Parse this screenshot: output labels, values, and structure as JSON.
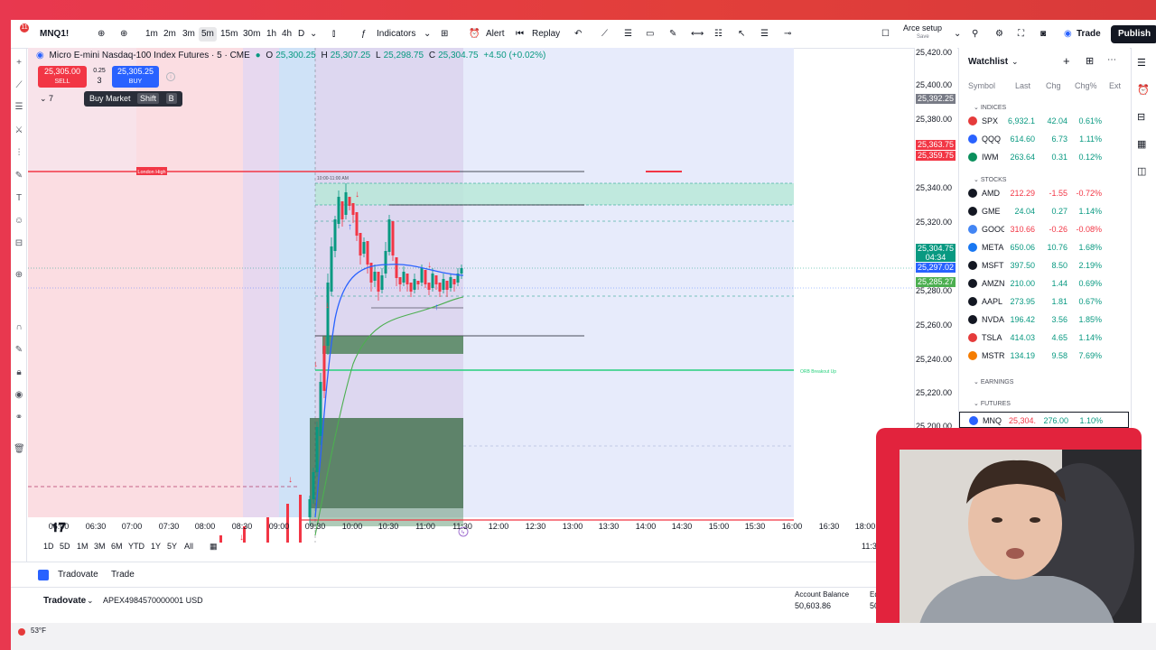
{
  "toolbar": {
    "symbol": "MNQ1!",
    "notif_count": "11",
    "timeframes": [
      "1m",
      "2m",
      "3m",
      "5m",
      "15m",
      "30m",
      "1h",
      "4h",
      "D"
    ],
    "active_timeframe": "5m",
    "indicators_label": "Indicators",
    "alert_label": "Alert",
    "replay_label": "Replay",
    "layout_name": "Arce setup",
    "layout_sub": "Save",
    "trade_label": "Trade",
    "publish_label": "Publish"
  },
  "legend": {
    "title": "Micro E-mini Nasdaq-100 Index Futures · 5 · CME",
    "o_label": "O",
    "o": "25,300.25",
    "h_label": "H",
    "h": "25,307.25",
    "l_label": "L",
    "l": "25,298.75",
    "c_label": "C",
    "c": "25,304.75",
    "change": "+4.50 (+0.02%)"
  },
  "order": {
    "sell_price": "25,305.00",
    "sell_label": "SELL",
    "spread": "0.25",
    "qty": "3",
    "buy_price": "25,305.25",
    "buy_label": "BUY",
    "tooltip": "Buy Market",
    "key1": "Shift",
    "key2": "B",
    "indicator_count": "7"
  },
  "annotations": {
    "london_high": "London High",
    "session_box": "10:00-11:00 AM",
    "orb_label": "ORB Breakout Up"
  },
  "price_axis": {
    "labels": [
      "25,420.00",
      "25,400.00",
      "25,380.00",
      "25,340.00",
      "25,320.00",
      "25,280.00",
      "25,260.00",
      "25,240.00",
      "25,220.00",
      "25,200.00"
    ],
    "tag_grey": "25,392.25",
    "tag_red1": "25,363.75",
    "tag_red2": "25,359.75",
    "tag_green_price": "25,304.75",
    "tag_green_time": "04:34",
    "tag_blue": "25,297.02",
    "tag_green2": "25,285.27"
  },
  "time_axis": [
    "06:00",
    "06:30",
    "07:00",
    "07:30",
    "08:00",
    "08:30",
    "09:00",
    "09:30",
    "10:00",
    "10:30",
    "11:00",
    "11:30",
    "12:00",
    "12:30",
    "13:00",
    "13:30",
    "14:00",
    "14:30",
    "15:00",
    "15:30",
    "16:00",
    "16:30",
    "18:00"
  ],
  "range_bar": {
    "ranges": [
      "1D",
      "5D",
      "1M",
      "3M",
      "6M",
      "YTD",
      "1Y",
      "5Y",
      "All"
    ],
    "clock": "11:30:25 UTC"
  },
  "bottom": {
    "tab1": "Tradovate",
    "tab2": "Trade",
    "broker": "Tradovate",
    "account": "APEX4984570000001 USD",
    "balance_label": "Account Balance",
    "balance_value": "50,603.86",
    "equity_label": "Eq",
    "equity_value": "50"
  },
  "watchlist": {
    "title": "Watchlist",
    "cols": [
      "Symbol",
      "Last",
      "Chg",
      "Chg%",
      "Ext"
    ],
    "sections": {
      "indices": "INDICES",
      "stocks": "STOCKS",
      "earnings": "EARNINGS",
      "futures": "FUTURES"
    },
    "indices": [
      {
        "sym": "SPX",
        "last": "6,932.1",
        "chg": "42.04",
        "pct": "0.61%",
        "color": "#e53b3b"
      },
      {
        "sym": "QQQ",
        "last": "614.60",
        "chg": "6.73",
        "pct": "1.11%",
        "color": "#2962ff"
      },
      {
        "sym": "IWM",
        "last": "263.64",
        "chg": "0.31",
        "pct": "0.12%",
        "color": "#0a8f5c"
      }
    ],
    "stocks": [
      {
        "sym": "AMD",
        "last": "212.29",
        "chg": "-1.55",
        "pct": "-0.72%",
        "color": "#131722",
        "neg": true
      },
      {
        "sym": "GME",
        "last": "24.04",
        "chg": "0.27",
        "pct": "1.14%",
        "color": "#131722",
        "neg": false
      },
      {
        "sym": "GOOG",
        "last": "310.66",
        "chg": "-0.26",
        "pct": "-0.08%",
        "color": "#4285f4",
        "neg": true
      },
      {
        "sym": "META",
        "last": "650.06",
        "chg": "10.76",
        "pct": "1.68%",
        "color": "#1877f2",
        "neg": false
      },
      {
        "sym": "MSFT",
        "last": "397.50",
        "chg": "8.50",
        "pct": "2.19%",
        "color": "#131722",
        "neg": false
      },
      {
        "sym": "AMZN",
        "last": "210.00",
        "chg": "1.44",
        "pct": "0.69%",
        "color": "#131722",
        "neg": false
      },
      {
        "sym": "AAPL",
        "last": "273.95",
        "chg": "1.81",
        "pct": "0.67%",
        "color": "#131722",
        "neg": false
      },
      {
        "sym": "NVDA",
        "last": "196.42",
        "chg": "3.56",
        "pct": "1.85%",
        "color": "#131722",
        "neg": false
      },
      {
        "sym": "TSLA",
        "last": "414.03",
        "chg": "4.65",
        "pct": "1.14%",
        "color": "#e53b3b",
        "neg": false
      },
      {
        "sym": "MSTR",
        "last": "134.19",
        "chg": "9.58",
        "pct": "7.69%",
        "color": "#f57c00",
        "neg": false
      }
    ],
    "futures": [
      {
        "sym": "MNQ",
        "last": "25,304.",
        "chg": "276.00",
        "pct": "1.10%",
        "color": "#2962ff"
      }
    ]
  },
  "taskbar": {
    "weather": "53°F"
  }
}
